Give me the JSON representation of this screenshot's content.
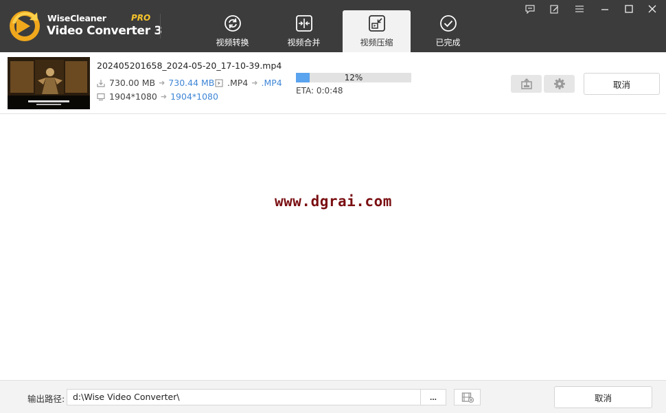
{
  "app": {
    "brand_top": "WiseCleaner",
    "brand_pro": "PRO",
    "brand_main": "Video Converter 3"
  },
  "tabs": [
    {
      "label": "视频转换",
      "icon": "refresh-icon",
      "active": false
    },
    {
      "label": "视频合并",
      "icon": "merge-icon",
      "active": false
    },
    {
      "label": "视频压缩",
      "icon": "compress-icon",
      "active": true
    },
    {
      "label": "已完成",
      "icon": "check-circle-icon",
      "active": false
    }
  ],
  "window_controls": [
    "message-icon",
    "edit-icon",
    "menu-icon",
    "minimize-icon",
    "maximize-icon",
    "close-icon"
  ],
  "task": {
    "filename": "202405201658_2024-05-20_17-10-39.mp4",
    "size_from": "730.00 MB",
    "size_to": "730.44 MB",
    "format_from": ".MP4",
    "format_to": ".MP4",
    "resolution_from": "1904*1080",
    "resolution_to": "1904*1080",
    "progress_percent": 12,
    "progress_label": "12%",
    "eta": "ETA: 0:0:48",
    "cancel_label": "取消"
  },
  "watermark": "www.dgrai.com",
  "footer": {
    "output_label": "输出路径:",
    "output_path": "d:\\Wise Video Converter\\",
    "browse_label": "...",
    "cancel_label": "取消"
  },
  "colors": {
    "header_bg": "#3c3c3c",
    "accent_blue": "#3f86d6",
    "progress_fill": "#5aa3ee",
    "pro_yellow": "#f5c32c",
    "watermark": "#7a0f12"
  }
}
